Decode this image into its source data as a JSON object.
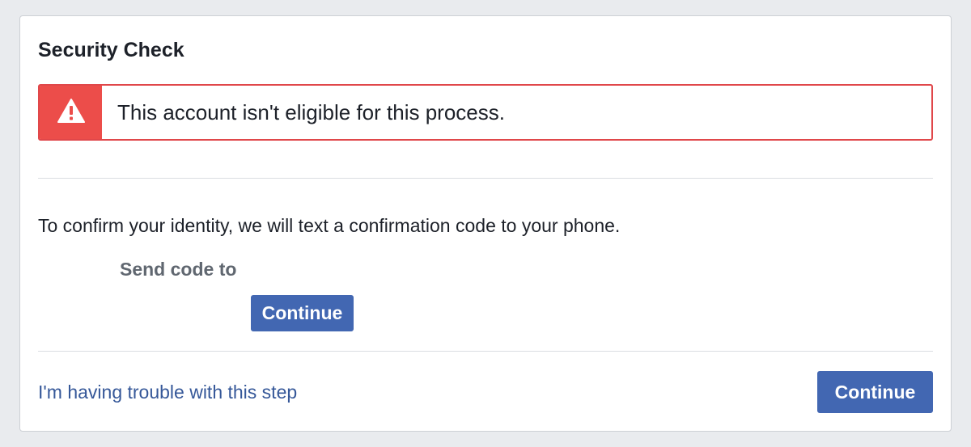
{
  "page": {
    "title": "Security Check"
  },
  "alert": {
    "message": "This account isn't eligible for this process.",
    "icon": "warning-triangle-icon",
    "colors": {
      "border": "#e0474a",
      "icon_bg": "#ec4d4a"
    }
  },
  "body": {
    "instruction": "To confirm your identity, we will text a confirmation code to your phone.",
    "send_code_label": "Send code to",
    "continue_label": "Continue"
  },
  "footer": {
    "trouble_link": "I'm having trouble with this step",
    "continue_label": "Continue"
  },
  "colors": {
    "primary_button": "#4267b2",
    "link": "#365899",
    "page_bg": "#e9ebee"
  }
}
